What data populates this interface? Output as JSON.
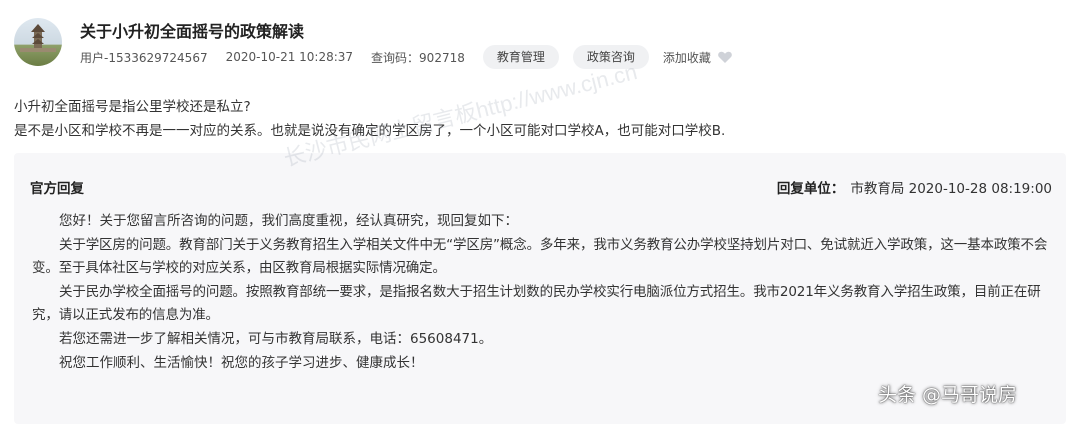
{
  "header": {
    "title": "关于小升初全面摇号的政策解读",
    "user": "用户-1533629724567",
    "datetime": "2020-10-21 10:28:37",
    "query_code": "查询码：902718",
    "tags": [
      "教育管理",
      "政策咨询"
    ],
    "favorite_label": "添加收藏"
  },
  "question": {
    "line1": "小升初全面摇号是指公里学校还是私立?",
    "line2": "是不是小区和学校不再是一一对应的关系。也就是说没有确定的学区房了，一个小区可能对口学校A，也可能对口学校B."
  },
  "reply": {
    "heading": "官方回复",
    "unit_label": "回复单位：",
    "unit_value": "市教育局 2020-10-28 08:19:00",
    "paragraphs": [
      "您好！关于您留言所咨询的问题，我们高度重视，经认真研究，现回复如下：",
      "关于学区房的问题。教育部门关于义务教育招生入学相关文件中无“学区房”概念。多年来，我市义务教育公办学校坚持划片对口、免试就近入学政策，这一基本政策不会变。至于具体社区与学校的对应关系，由区教育局根据实际情况确定。",
      "关于民办学校全面摇号的问题。按照教育部统一要求，是指报名数大于招生计划数的民办学校实行电脑派位方式招生。我市2021年义务教育入学招生政策，目前正在研究，请以正式发布的信息为准。",
      "若您还需进一步了解相关情况，可与市教育局联系，电话：65608471。",
      "祝您工作顺利、生活愉快！祝您的孩子学习进步、健康成长！"
    ]
  },
  "watermark": "长沙市民网上留言板http://www.cjn.cn",
  "brand": "头条 @马哥说房",
  "icons": {
    "avatar": "avatar-image",
    "favorite": "heart-icon"
  }
}
